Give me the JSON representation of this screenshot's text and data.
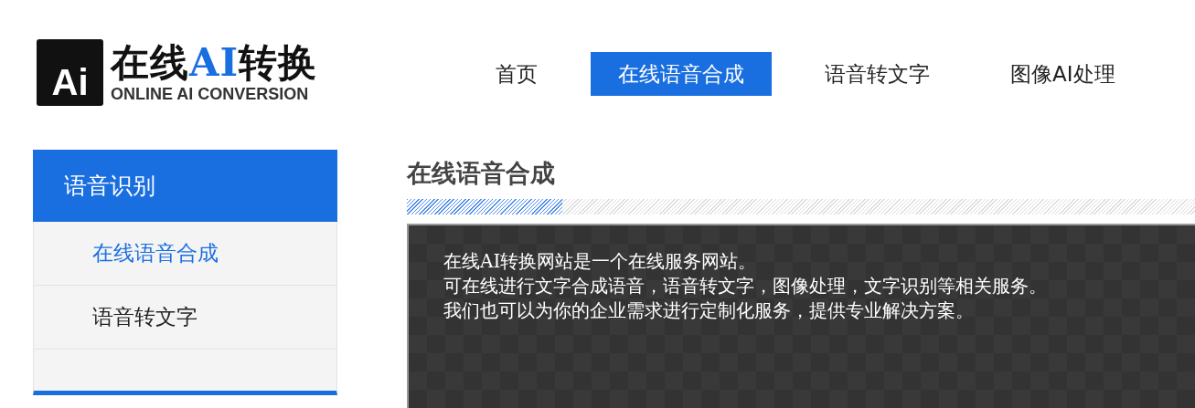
{
  "logo": {
    "mark": "Ai",
    "title_start": "在线",
    "title_highlight": "AI",
    "title_end": "转换",
    "subtitle": "ONLINE AI CONVERSION"
  },
  "nav": [
    {
      "label": "首页",
      "selected": false
    },
    {
      "label": "在线语音合成",
      "selected": true
    },
    {
      "label": "语音转文字",
      "selected": false
    },
    {
      "label": "图像AI处理",
      "selected": false
    }
  ],
  "sidebar": {
    "heading": "语音识别",
    "items": [
      {
        "label": "在线语音合成",
        "selected": true
      },
      {
        "label": "语音转文字",
        "selected": false
      }
    ]
  },
  "content": {
    "title": "在线语音合成",
    "paragraphs": [
      "在线AI转换网站是一个在线服务网站。",
      "可在线进行文字合成语音，语音转文字，图像处理，文字识别等相关服务。",
      "我们也可以为你的企业需求进行定制化服务，提供专业解决方案。"
    ]
  }
}
